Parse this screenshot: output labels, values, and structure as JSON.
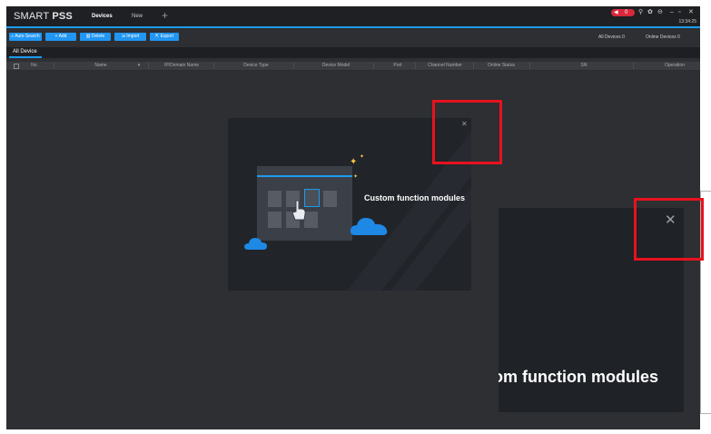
{
  "app": {
    "logo_prefix": "SMART ",
    "logo_bold": "PSS",
    "tabs": [
      {
        "label": "Devices"
      },
      {
        "label": "New"
      }
    ],
    "add_tab_icon": "plus-icon",
    "alarm_badge": "0",
    "clock": "13:34:25",
    "accent_color": "#1d9bf0",
    "alarm_color": "#d9283b"
  },
  "toolbar": {
    "buttons": [
      {
        "label": "Auto Search",
        "icon": "search-icon"
      },
      {
        "label": "Add",
        "icon": "plus-icon"
      },
      {
        "label": "Delete",
        "icon": "trash-icon"
      },
      {
        "label": "Import",
        "icon": "import-icon"
      },
      {
        "label": "Export",
        "icon": "export-icon"
      }
    ],
    "all_devices": "All Devices  0",
    "online_devices": "Online Devices  0"
  },
  "subtab": {
    "label": "All Device"
  },
  "table": {
    "columns": [
      "No.",
      "Name",
      "IP/Domain Name",
      "Device Type",
      "Device Model",
      "Port",
      "Channel Number",
      "Online Status",
      "SN",
      "Operation"
    ]
  },
  "modal": {
    "title": "Custom function modules",
    "close_icon": "close-icon"
  },
  "zoom": {
    "title": "om function modules",
    "close_icon": "close-icon"
  },
  "highlight_color": "#e8121d"
}
